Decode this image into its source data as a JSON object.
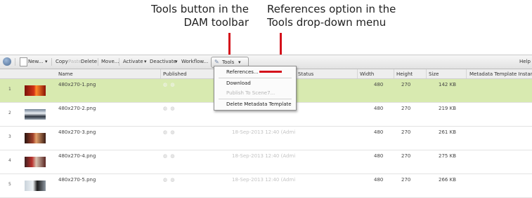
{
  "callouts": {
    "tools": {
      "line1": "Tools button in the",
      "line2": "DAM toolbar"
    },
    "references": {
      "line1": "References option in the",
      "line2": "Tools drop-down menu"
    }
  },
  "colors": {
    "callout_line": "#d4111b",
    "selected_row": "#d8eab0"
  },
  "toolbar": {
    "new": "New...",
    "copy": "Copy",
    "paste": "Paste",
    "delete": "Delete",
    "move": "Move...",
    "activate": "Activate",
    "deactivate": "Deactivate",
    "workflow": "Workflow...",
    "tools": "Tools",
    "help": "Help"
  },
  "columns": {
    "name": "Name",
    "published": "Published",
    "status": "Status",
    "width": "Width",
    "height": "Height",
    "size": "Size",
    "metadata_template": "Metadata Template Instan..."
  },
  "rows": [
    {
      "num": "1",
      "name": "480x270-1.png",
      "published": "◍ ◍",
      "modified": "",
      "width": "480",
      "height": "270",
      "size": "142 KB",
      "selected": true
    },
    {
      "num": "2",
      "name": "480x270-2.png",
      "published": "◍ ◍",
      "modified": "",
      "width": "480",
      "height": "270",
      "size": "219 KB"
    },
    {
      "num": "3",
      "name": "480x270-3.png",
      "published": "◍ ◍",
      "modified": "18-Sep-2013 12:40 (Admi",
      "width": "480",
      "height": "270",
      "size": "261 KB"
    },
    {
      "num": "4",
      "name": "480x270-4.png",
      "published": "◍ ◍",
      "modified": "18-Sep-2013 12:40 (Admi",
      "width": "480",
      "height": "270",
      "size": "275 KB"
    },
    {
      "num": "5",
      "name": "480x270-5.png",
      "published": "◍ ◍",
      "modified": "18-Sep-2013 12:40 (Admi",
      "width": "480",
      "height": "270",
      "size": "266 KB"
    }
  ],
  "menu": {
    "references": "References...",
    "download": "Download",
    "publish": "Publish To Scene7...",
    "delete_meta": "Delete Metadata Template"
  }
}
